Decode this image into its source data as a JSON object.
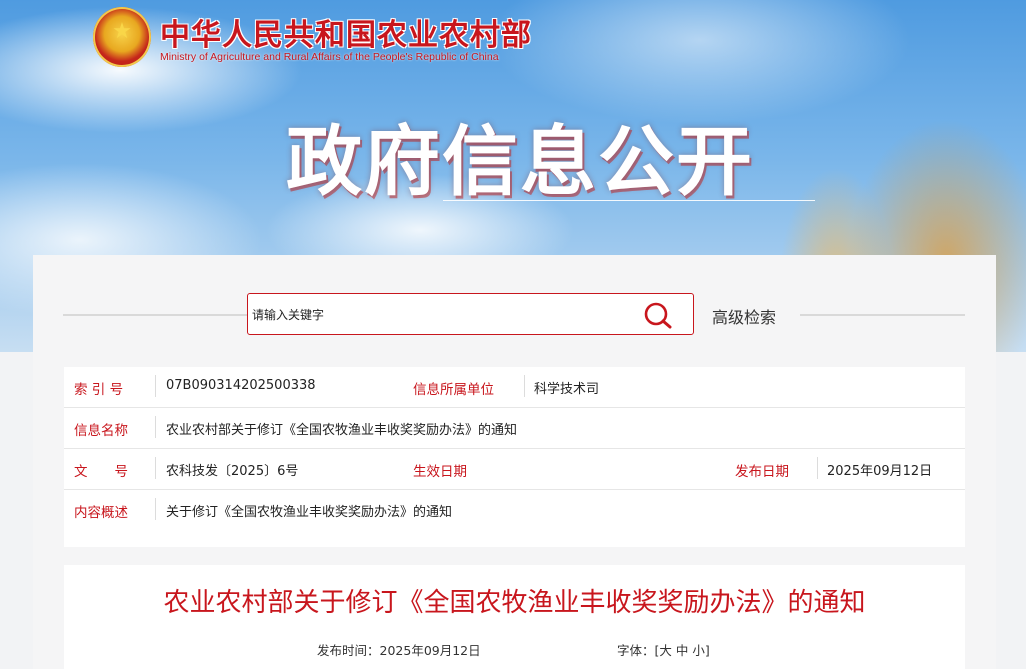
{
  "header": {
    "ministry_cn": "中华人民共和国农业农村部",
    "ministry_en": "Ministry of Agriculture and Rural Affairs of the People's Republic of China",
    "page_title": "政府信息公开"
  },
  "search": {
    "placeholder": "请输入关键字",
    "advanced_label": "高级检索",
    "icon": "search-icon"
  },
  "info": {
    "index_label": "索 引 号",
    "index_value": "07B090314202500338",
    "unit_label": "信息所属单位",
    "unit_value": "科学技术司",
    "name_label": "信息名称",
    "name_value": "农业农村部关于修订《全国农牧渔业丰收奖奖励办法》的通知",
    "doc_label": "文　　号",
    "doc_value": "农科技发〔2025〕6号",
    "effective_label": "生效日期",
    "effective_value": "",
    "publish_label": "发布日期",
    "publish_value": "2025年09月12日",
    "summary_label": "内容概述",
    "summary_value": "关于修订《全国农牧渔业丰收奖奖励办法》的通知"
  },
  "article": {
    "title": "农业农村部关于修订《全国农牧渔业丰收奖奖励办法》的通知",
    "publish_time_label": "发布时间：",
    "publish_time": "2025年09月12日",
    "font_label": "字体：",
    "font_open": "[",
    "font_large": "大",
    "font_medium": "中",
    "font_small": "小",
    "font_close": "]"
  },
  "colors": {
    "accent": "#c8161d",
    "panel": "#f5f5f6"
  }
}
